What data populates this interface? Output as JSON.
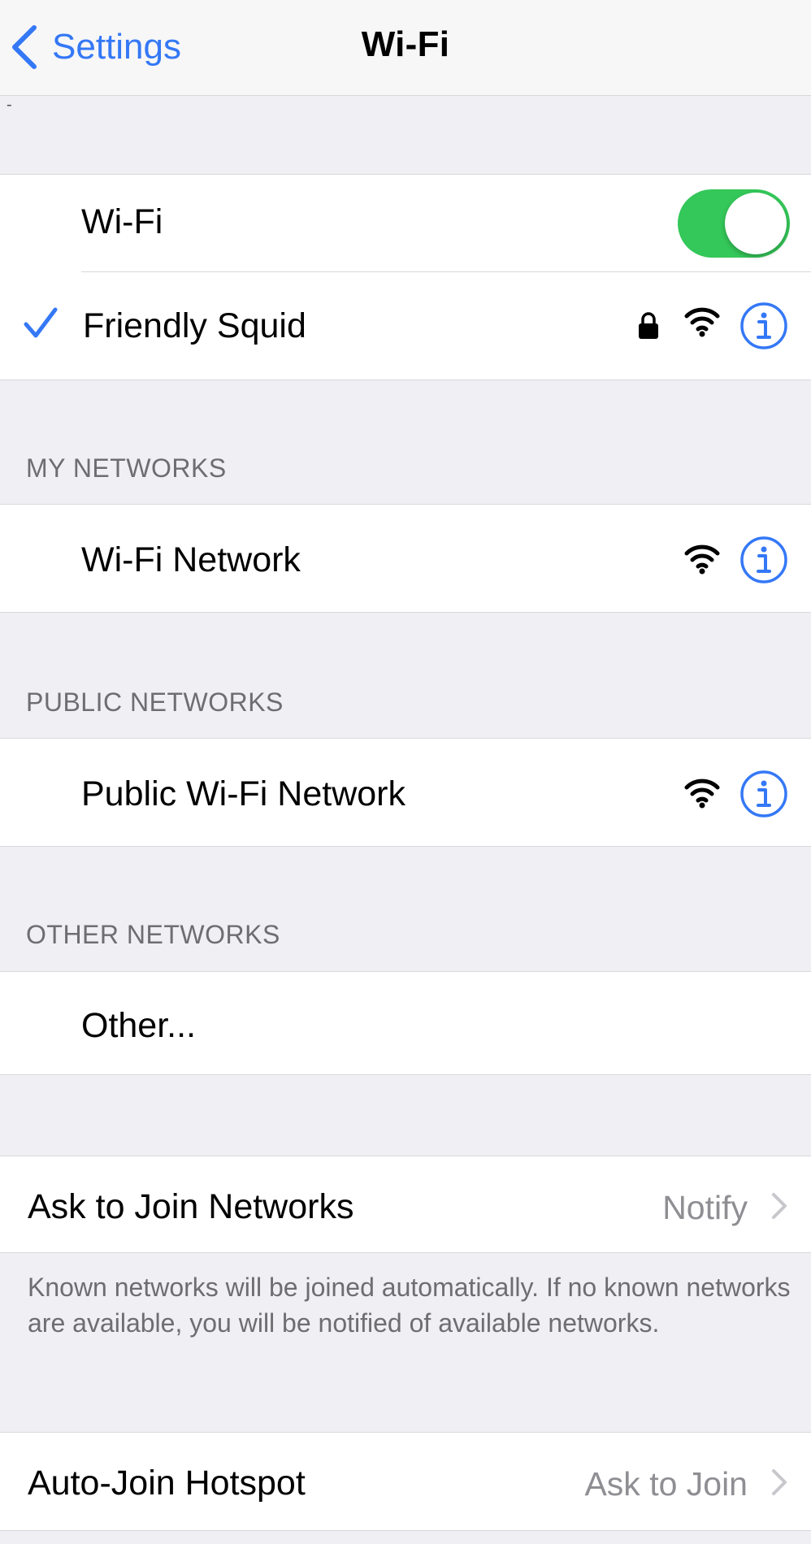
{
  "nav": {
    "back_label": "Settings",
    "title": "Wi-Fi"
  },
  "stray_mark": "-",
  "wifi_toggle": {
    "label": "Wi-Fi",
    "on": true,
    "color": "#34c759"
  },
  "connected": {
    "name": "Friendly Squid",
    "secured": true
  },
  "my_networks": {
    "header": "MY NETWORKS",
    "items": [
      {
        "name": "Wi-Fi Network"
      }
    ]
  },
  "public_networks": {
    "header": "PUBLIC NETWORKS",
    "items": [
      {
        "name": "Public Wi-Fi Network"
      }
    ]
  },
  "other_networks": {
    "header": "OTHER NETWORKS",
    "items": [
      {
        "name": "Other..."
      }
    ]
  },
  "ask_to_join": {
    "label": "Ask to Join Networks",
    "value": "Notify",
    "footer": "Known networks will be joined automatically. If no known networks are available, you will be notified of available networks."
  },
  "auto_join": {
    "label": "Auto-Join Hotspot",
    "value": "Ask to Join"
  },
  "colors": {
    "accent": "#3478f6",
    "switch_on": "#34c759",
    "background": "#efeff4"
  },
  "icons": [
    "chevron-left-icon",
    "checkmark-icon",
    "lock-icon",
    "wifi-signal-icon",
    "info-icon",
    "chevron-right-icon"
  ]
}
